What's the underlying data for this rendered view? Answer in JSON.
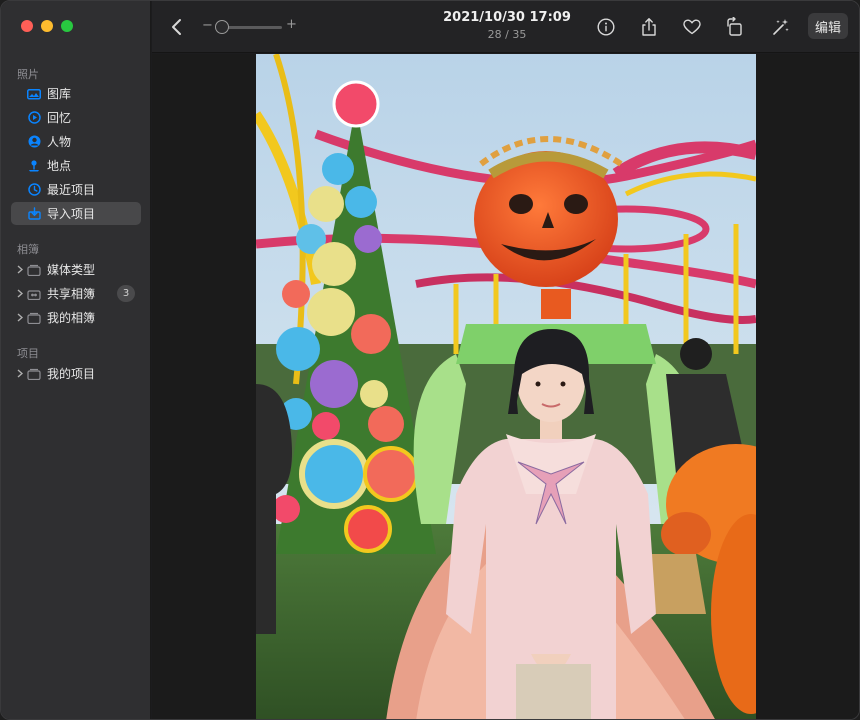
{
  "window": {
    "traffic_lights": [
      "close",
      "minimize",
      "zoom"
    ]
  },
  "sidebar": {
    "photos_section": "照片",
    "photos_items": [
      {
        "label": "图库",
        "icon": "library-icon"
      },
      {
        "label": "回忆",
        "icon": "memories-icon"
      },
      {
        "label": "人物",
        "icon": "people-icon"
      },
      {
        "label": "地点",
        "icon": "places-icon"
      },
      {
        "label": "最近项目",
        "icon": "recents-icon"
      },
      {
        "label": "导入项目",
        "icon": "imports-icon",
        "selected": true
      }
    ],
    "albums_section": "相簿",
    "albums_items": [
      {
        "label": "媒体类型",
        "icon": "media-types-icon"
      },
      {
        "label": "共享相簿",
        "icon": "shared-albums-icon",
        "badge": "3"
      },
      {
        "label": "我的相簿",
        "icon": "my-albums-icon"
      }
    ],
    "projects_section": "项目",
    "projects_items": [
      {
        "label": "我的项目",
        "icon": "my-projects-icon"
      }
    ]
  },
  "toolbar": {
    "date_time": "2021/10/30 17:09",
    "position": "28 / 35",
    "zoom_minus": "−",
    "zoom_plus": "+",
    "zoom_level": 0.05,
    "edit_label": "编辑"
  },
  "photo": {
    "description_icon": "photo-image"
  },
  "colors": {
    "accent": "#0a84ff",
    "sidebar_bg": "#2f2f31",
    "toolbar_bg": "#232325",
    "selection": "#48484a"
  }
}
